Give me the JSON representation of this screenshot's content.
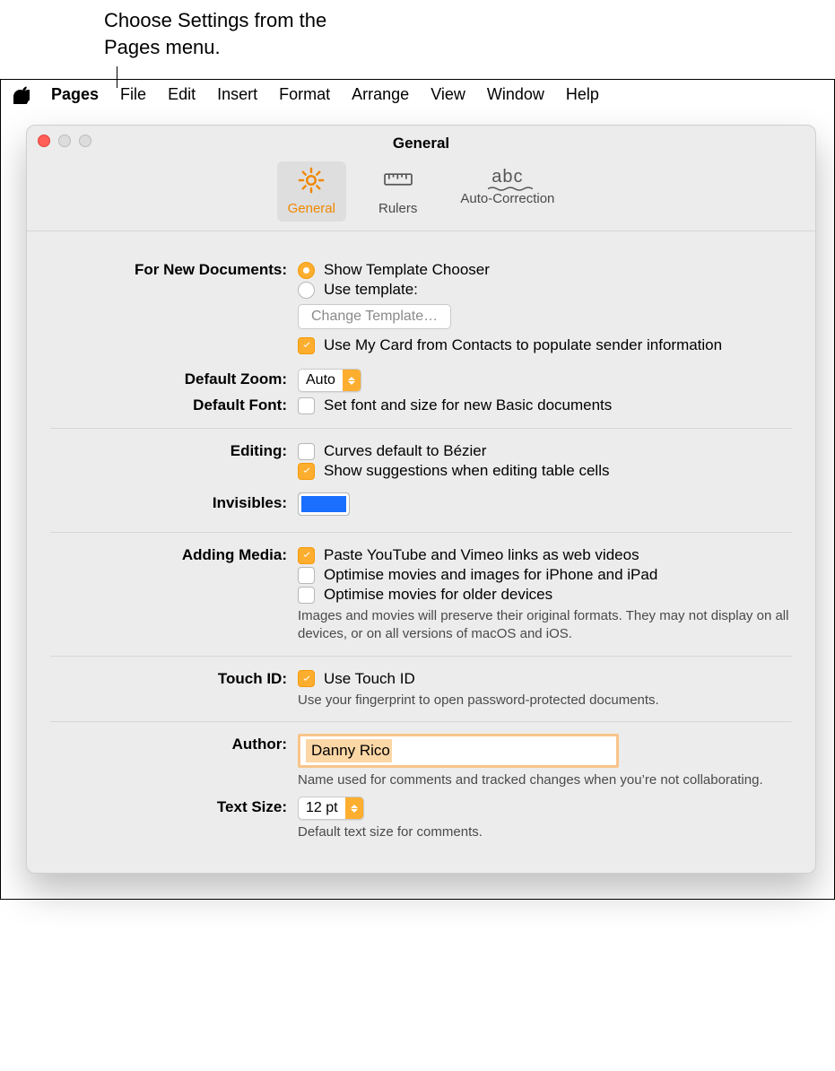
{
  "annotation": "Choose Settings from the Pages menu.",
  "menubar": {
    "items": [
      "Pages",
      "File",
      "Edit",
      "Insert",
      "Format",
      "Arrange",
      "View",
      "Window",
      "Help"
    ]
  },
  "window": {
    "title": "General",
    "tabs": {
      "general": "General",
      "rulers": "Rulers",
      "autocorrect": "Auto-Correction"
    }
  },
  "newdocs": {
    "label": "For New Documents:",
    "radio_chooser": "Show Template Chooser",
    "radio_template": "Use template:",
    "change_template_btn": "Change Template…",
    "use_my_card": "Use My Card from Contacts to populate sender information"
  },
  "default_zoom": {
    "label": "Default Zoom:",
    "value": "Auto"
  },
  "default_font": {
    "label": "Default Font:",
    "set_font": "Set font and size for new Basic documents"
  },
  "editing": {
    "label": "Editing:",
    "bezier": "Curves default to Bézier",
    "suggestions": "Show suggestions when editing table cells"
  },
  "invisibles": {
    "label": "Invisibles:",
    "color": "#1a6fff"
  },
  "media": {
    "label": "Adding Media:",
    "yt": "Paste YouTube and Vimeo links as web videos",
    "opt1": "Optimise movies and images for iPhone and iPad",
    "opt2": "Optimise movies for older devices",
    "hint": "Images and movies will preserve their original formats. They may not display on all devices, or on all versions of macOS and iOS."
  },
  "touchid": {
    "label": "Touch ID:",
    "use": "Use Touch ID",
    "hint": "Use your fingerprint to open password-protected documents."
  },
  "author": {
    "label": "Author:",
    "value": "Danny Rico",
    "hint": "Name used for comments and tracked changes when you’re not collaborating."
  },
  "textsize": {
    "label": "Text Size:",
    "value": "12 pt",
    "hint": "Default text size for comments."
  }
}
